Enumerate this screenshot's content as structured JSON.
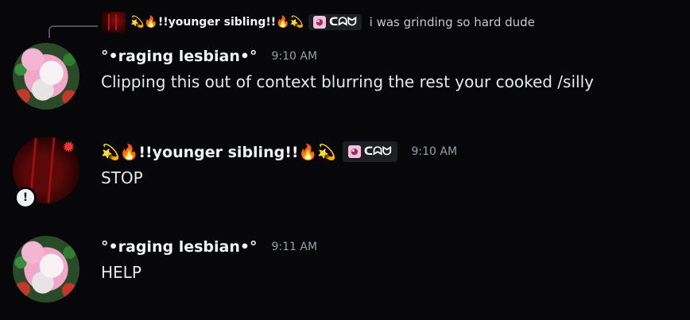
{
  "reply": {
    "username": "💫🔥!!younger sibling!!🔥💫",
    "tag_text": "ᑕᗣᗢ",
    "text": "i was grinding so hard dude"
  },
  "messages": [
    {
      "username": "°•raging lesbian•°",
      "timestamp": "9:10 AM",
      "content": "Clipping this out of context blurring the rest your cooked /silly"
    },
    {
      "username_prefix": "💫🔥",
      "username": "!!younger sibling!!",
      "username_suffix": "🔥💫",
      "tag_text": "ᑕᗣᗢ",
      "timestamp": "9:10 AM",
      "content": "STOP",
      "status_badge": "!"
    },
    {
      "username": "°•raging lesbian•°",
      "timestamp": "9:11 AM",
      "content": "HELP"
    }
  ],
  "icons": {
    "tag_icon": "cat-face-icon",
    "anger_icon": "anger-symbol-icon",
    "status_icon": "exclamation-icon"
  },
  "colors": {
    "background": "#070709",
    "username": "#f2f3f5",
    "timestamp": "#9a9ea6",
    "tag_background": "#1e1f24"
  }
}
